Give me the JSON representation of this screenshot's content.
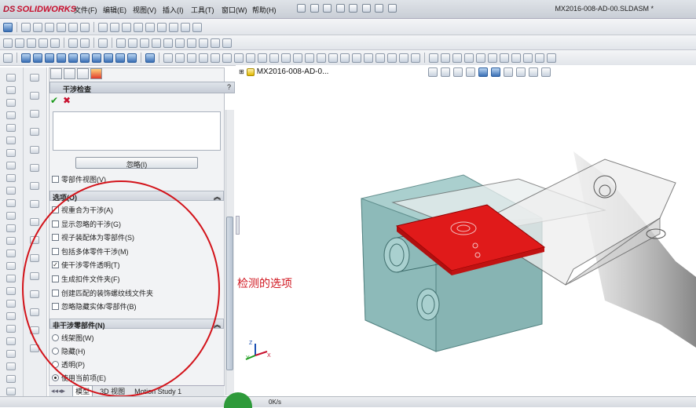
{
  "app": {
    "brand_ds": "DS",
    "brand_name": "SOLIDWORKS",
    "document_title": "MX2016-008-AD-00.SLDASM *"
  },
  "menu": [
    "文件(F)",
    "编辑(E)",
    "视图(V)",
    "插入(I)",
    "工具(T)",
    "窗口(W)",
    "帮助(H)"
  ],
  "tree": {
    "root_label": "MX2016-008-AD-0..."
  },
  "property_manager": {
    "title": "干涉检查",
    "help": "?",
    "ok_icon": "check-icon",
    "cancel_icon": "close-icon",
    "ignore_button": "忽略(I)",
    "part_view_label": "零部件视图(V)"
  },
  "options_group": {
    "title": "选项(O)",
    "items": [
      {
        "label": "视重合为干涉(A)",
        "checked": false
      },
      {
        "label": "显示忽略的干涉(G)",
        "checked": false
      },
      {
        "label": "视子装配体为零部件(S)",
        "checked": false
      },
      {
        "label": "包括多体零件干涉(M)",
        "checked": false
      },
      {
        "label": "使干涉零件透明(T)",
        "checked": true
      },
      {
        "label": "生成扣件文件夹(F)",
        "checked": false
      },
      {
        "label": "创建匹配的装饰螺纹线文件夹",
        "checked": false
      },
      {
        "label": "忽略隐藏实体/零部件(B)",
        "checked": false
      }
    ]
  },
  "non_interfering_group": {
    "title": "非干涉零部件(N)",
    "items": [
      {
        "label": "线架图(W)",
        "selected": false
      },
      {
        "label": "隐藏(H)",
        "selected": false
      },
      {
        "label": "透明(P)",
        "selected": false
      },
      {
        "label": "使用当前项(E)",
        "selected": true
      }
    ]
  },
  "bottom_tabs": [
    "模型",
    "3D 视图",
    "Motion Study 1"
  ],
  "annotation": "检测的选项",
  "status": {
    "net_speed": "0K/s"
  },
  "triad": {
    "x": "X",
    "y": "Y",
    "z": "Z"
  },
  "colors": {
    "interference": "#e01a1a",
    "body": "#7fb7b5",
    "annotation": "#d0161f"
  }
}
